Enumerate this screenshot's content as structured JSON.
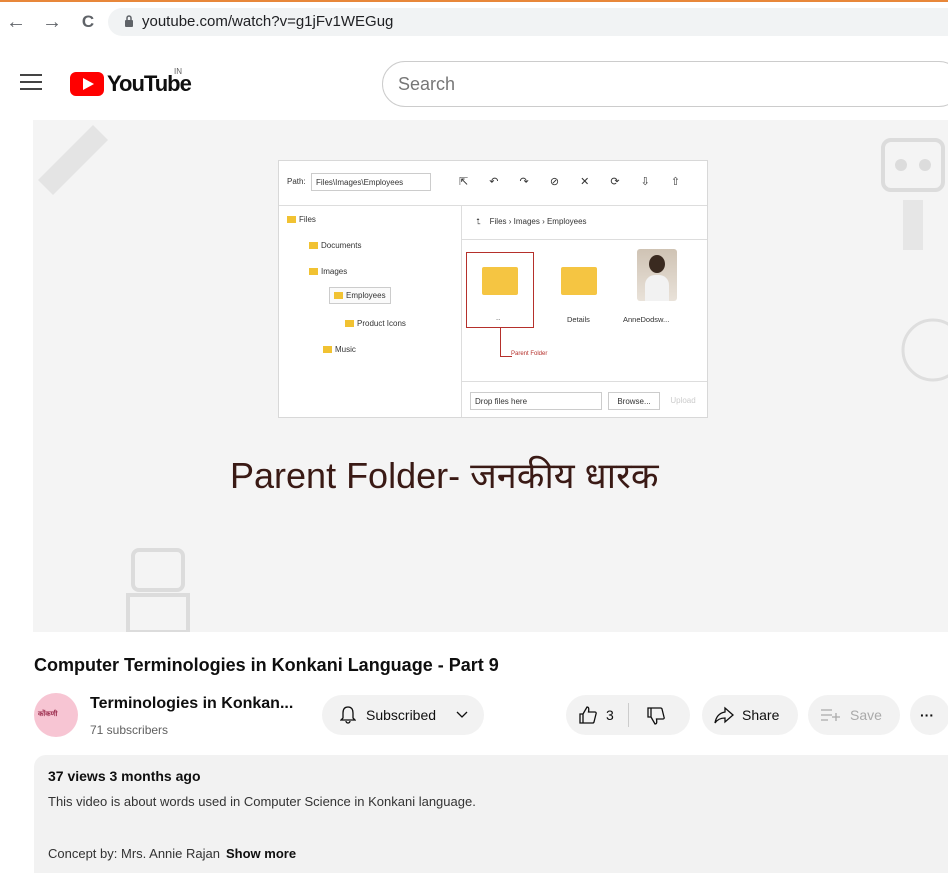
{
  "browser": {
    "url": "youtube.com/watch?v=g1jFv1WEGug",
    "back_icon": "←",
    "forward_icon": "→",
    "reload_icon": "C"
  },
  "header": {
    "logo_text": "YouTube",
    "country_code": "IN",
    "search_placeholder": "Search"
  },
  "video_frame": {
    "path_label": "Path:",
    "path_value": "Files\\Images\\Employees",
    "toolbar_icons": "⇱ ↶ ↷ ⊘ ✕ ⟳ ⇩ ⇧",
    "tree": [
      "Files",
      "Documents",
      "Images",
      "Employees",
      "Product Icons",
      "Music"
    ],
    "breadcrumb": "Files › Images › Employees",
    "up_icon": "⮤",
    "items": [
      {
        "label": ".."
      },
      {
        "label": "Details"
      },
      {
        "label": "AnneDodsw..."
      }
    ],
    "parent_folder_callout": "Parent Folder",
    "drop_text": "Drop files here",
    "browse": "Browse...",
    "upload": "Upload",
    "caption": "Parent Folder- जनकीय धारक"
  },
  "video": {
    "title": "Computer Terminologies in Konkani Language - Part 9"
  },
  "channel": {
    "avatar_text": "कोंकणी",
    "name": "Terminologies in Konkan...",
    "subscribers": "71 subscribers"
  },
  "actions": {
    "subscribed": "Subscribed",
    "likes": "3",
    "share": "Share",
    "save": "Save",
    "more": "···"
  },
  "description": {
    "meta": "37 views  3 months ago",
    "line1": "This video is about words used in Computer Science in Konkani language.",
    "line2": "Concept by: Mrs. Annie Rajan",
    "show_more": "Show more"
  }
}
